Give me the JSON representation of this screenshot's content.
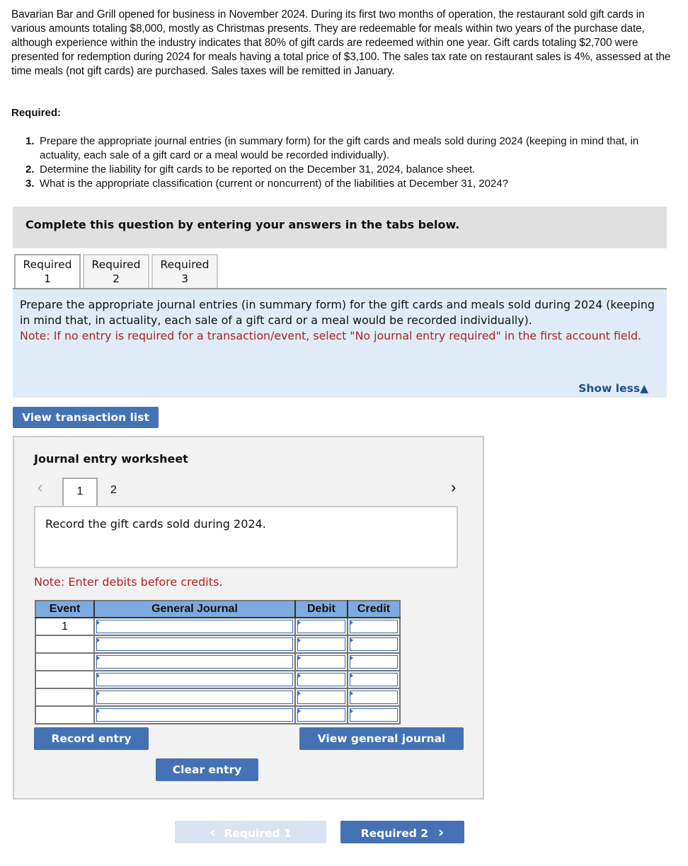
{
  "problem": {
    "intro": "Bavarian Bar and Grill opened for business in November 2024. During its first two months of operation, the restaurant sold gift cards in various amounts totaling $8,000, mostly as Christmas presents. They are redeemable for meals within two years of the purchase date, although experience within the industry indicates that 80% of gift cards are redeemed within one year. Gift cards totaling $2,700 were presented for redemption during 2024 for meals having a total price of $3,100. The sales tax rate on restaurant sales is 4%, assessed at the time meals (not gift cards) are purchased. Sales taxes will be remitted in January.",
    "required_heading": "Required:",
    "requirements": [
      {
        "num": "1.",
        "text": "Prepare the appropriate journal entries (in summary form) for the gift cards and meals sold during 2024 (keeping in mind that, in actuality, each sale of a gift card or a meal would be recorded individually)."
      },
      {
        "num": "2.",
        "text": "Determine the liability for gift cards to be reported on the December 31, 2024, balance sheet."
      },
      {
        "num": "3.",
        "text": "What is the appropriate classification (current or noncurrent) of the liabilities at December 31, 2024?"
      }
    ]
  },
  "banner": "Complete this question by entering your answers in the tabs below.",
  "tabs": [
    {
      "line1": "Required",
      "line2": "1",
      "active": true
    },
    {
      "line1": "Required",
      "line2": "2",
      "active": false
    },
    {
      "line1": "Required",
      "line2": "3",
      "active": false
    }
  ],
  "instructions": {
    "text": "Prepare the appropriate journal entries (in summary form) for the gift cards and meals sold during 2024 (keeping in mind that, in actuality, each sale of a gift card or a meal would be recorded individually).",
    "note": "Note: If no entry is required for a transaction/event, select \"No journal entry required\" in the first account field.",
    "show_less": "Show less▲"
  },
  "view_transaction_list": "View transaction list",
  "worksheet": {
    "title": "Journal entry worksheet",
    "prev_icon": "‹",
    "next_icon": "›",
    "pages": [
      "1",
      "2"
    ],
    "description": "Record the gift cards sold during 2024.",
    "note": "Note: Enter debits before credits.",
    "columns": [
      "Event",
      "General Journal",
      "Debit",
      "Credit"
    ],
    "rows": [
      {
        "event": "1",
        "account": "",
        "debit": "",
        "credit": ""
      },
      {
        "event": "",
        "account": "",
        "debit": "",
        "credit": ""
      },
      {
        "event": "",
        "account": "",
        "debit": "",
        "credit": ""
      },
      {
        "event": "",
        "account": "",
        "debit": "",
        "credit": ""
      },
      {
        "event": "",
        "account": "",
        "debit": "",
        "credit": ""
      },
      {
        "event": "",
        "account": "",
        "debit": "",
        "credit": ""
      }
    ],
    "record_entry": "Record entry",
    "clear_entry": "Clear entry",
    "view_general_journal": "View general journal"
  },
  "nav": {
    "prev_label": "Required 1",
    "next_label": "Required 2",
    "prev_icon": "‹",
    "next_icon": "›"
  }
}
